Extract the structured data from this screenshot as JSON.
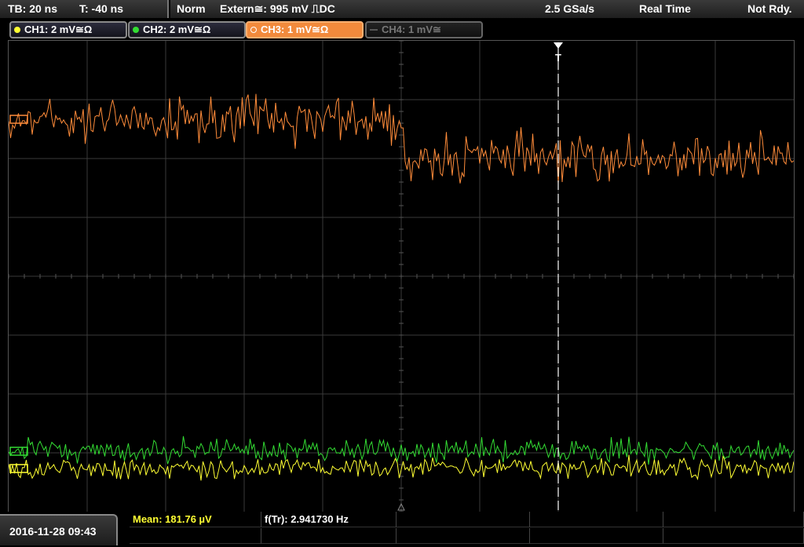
{
  "topbar": {
    "timebase": "TB: 20 ns",
    "trigger_time": "T: -40 ns",
    "trigger_mode": "Norm",
    "trigger_source": "Extern≅: 995 mV ⎍DC",
    "sample_rate": "2.5 GSa/s",
    "acq_mode": "Real Time",
    "status": "Not Rdy."
  },
  "channels": [
    {
      "label": "CH1: 2 mV≅Ω",
      "color": "#ffff33"
    },
    {
      "label": "CH2: 2 mV≅Ω",
      "color": "#33dd33"
    },
    {
      "label": "CH3: 1 mV≅Ω",
      "color": "#ff8c3a"
    },
    {
      "label": "CH4: 1 mV≅",
      "color": "#666666"
    }
  ],
  "trigger_marker": "T",
  "measurements": {
    "mean": "Mean: 181.76 µV",
    "freq": "f(Tr): 2.941730 Hz"
  },
  "datetime": "2016-11-28 09:43",
  "colors": {
    "ch1": "#ffff33",
    "ch2": "#33dd33",
    "ch3": "#ff8c3a",
    "grid": "#3a3a3a",
    "trigger_line": "#ffffff"
  }
}
